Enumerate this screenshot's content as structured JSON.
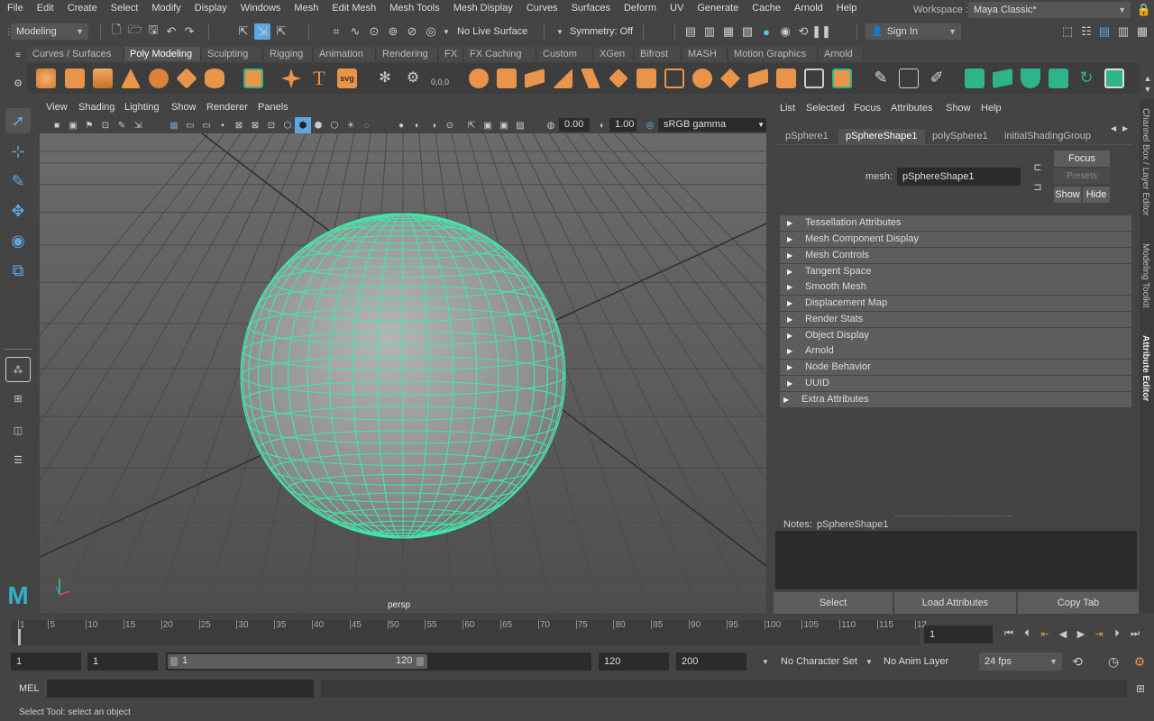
{
  "menubar": {
    "items": [
      "File",
      "Edit",
      "Create",
      "Select",
      "Modify",
      "Display",
      "Windows",
      "Mesh",
      "Edit Mesh",
      "Mesh Tools",
      "Mesh Display",
      "Curves",
      "Surfaces",
      "Deform",
      "UV",
      "Generate",
      "Cache",
      "Arnold",
      "Help"
    ],
    "workspace_label": "Workspace :",
    "workspace_value": "Maya Classic*"
  },
  "statusline": {
    "menuset": "Modeling",
    "live_surface": "No Live Surface",
    "symmetry": "Symmetry: Off",
    "sign_in": "Sign In"
  },
  "shelf": {
    "tabs": [
      "Curves / Surfaces",
      "Poly Modeling",
      "Sculpting",
      "Rigging",
      "Animation",
      "Rendering",
      "FX",
      "FX Caching",
      "Custom",
      "XGen",
      "Bifrost",
      "MASH",
      "Motion Graphics",
      "Arnold"
    ],
    "active_tab": "Poly Modeling",
    "svg_label": "svg",
    "coord_label": "0,0,0"
  },
  "viewport": {
    "menus": [
      "View",
      "Shading",
      "Lighting",
      "Show",
      "Renderer",
      "Panels"
    ],
    "exposure": "0.00",
    "gamma": "1.00",
    "colorspace": "sRGB gamma",
    "camera": "persp"
  },
  "attribute_editor": {
    "menus": [
      "List",
      "Selected",
      "Focus",
      "Attributes",
      "Show",
      "Help"
    ],
    "tabs": [
      "pSphere1",
      "pSphereShape1",
      "polySphere1",
      "initialShadingGroup"
    ],
    "active_tab": "pSphereShape1",
    "mesh_label": "mesh:",
    "mesh_value": "pSphereShape1",
    "focus_button": "Focus",
    "presets_button": "Presets",
    "show_button": "Show",
    "hide_button": "Hide",
    "sections": [
      "Tessellation Attributes",
      "Mesh Component Display",
      "Mesh Controls",
      "Tangent Space",
      "Smooth Mesh",
      "Displacement Map",
      "Render Stats",
      "Object Display",
      "Arnold",
      "Node Behavior",
      "UUID",
      "Extra Attributes"
    ],
    "notes_label": "Notes:",
    "notes_value": "pSphereShape1",
    "select_button": "Select",
    "load_attributes_button": "Load Attributes",
    "copy_tab_button": "Copy Tab"
  },
  "side_tabs": [
    "Channel Box / Layer Editor",
    "Modeling Toolkit",
    "Attribute Editor"
  ],
  "timeline": {
    "ticks": [
      "1",
      "5",
      "10",
      "15",
      "20",
      "25",
      "30",
      "35",
      "40",
      "45",
      "50",
      "55",
      "60",
      "65",
      "70",
      "75",
      "80",
      "85",
      "90",
      "95",
      "100",
      "105",
      "110",
      "115",
      "12"
    ],
    "current_frame": "1"
  },
  "range": {
    "start": "1",
    "playback_start": "1",
    "slider_start": "1",
    "slider_end": "120",
    "playback_end": "120",
    "end": "200",
    "character_set": "No Character Set",
    "anim_layer": "No Anim Layer",
    "fps": "24 fps"
  },
  "command": {
    "lang": "MEL",
    "input": "",
    "output": ""
  },
  "help_line": "Select Tool: select an object",
  "colors": {
    "accent_orange": "#e8944a",
    "wire_green": "#3ee8a8",
    "shelf_green": "#2fb38a",
    "select_blue": "#5ea6e0"
  }
}
